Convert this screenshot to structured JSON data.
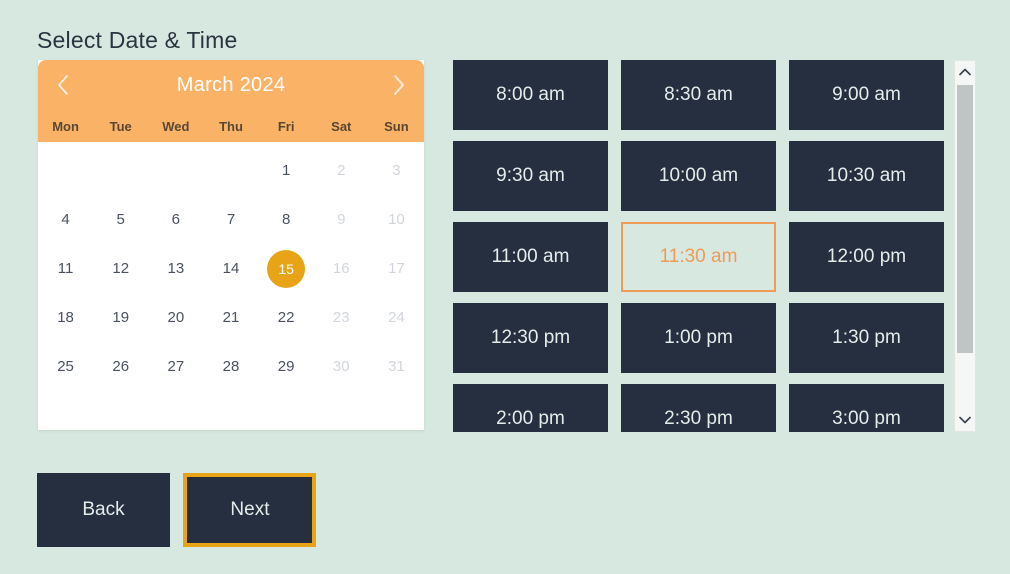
{
  "page": {
    "title": "Select Date & Time",
    "background_color": "#d6e8df",
    "accent_color": "#f9b266",
    "selected_color": "#e8a317",
    "slot_color": "#252f40"
  },
  "calendar": {
    "month_label": "March 2024",
    "prev_icon": "chevron-left-icon",
    "next_icon": "chevron-right-icon",
    "weekdays": [
      "Mon",
      "Tue",
      "Wed",
      "Thu",
      "Fri",
      "Sat",
      "Sun"
    ],
    "leading_blanks": 4,
    "selected_day": 15,
    "days": [
      {
        "n": "1",
        "state": "enabled"
      },
      {
        "n": "2",
        "state": "disabled"
      },
      {
        "n": "3",
        "state": "disabled"
      },
      {
        "n": "4",
        "state": "enabled"
      },
      {
        "n": "5",
        "state": "enabled"
      },
      {
        "n": "6",
        "state": "enabled"
      },
      {
        "n": "7",
        "state": "enabled"
      },
      {
        "n": "8",
        "state": "enabled"
      },
      {
        "n": "9",
        "state": "disabled"
      },
      {
        "n": "10",
        "state": "disabled"
      },
      {
        "n": "11",
        "state": "enabled"
      },
      {
        "n": "12",
        "state": "enabled"
      },
      {
        "n": "13",
        "state": "enabled"
      },
      {
        "n": "14",
        "state": "enabled"
      },
      {
        "n": "15",
        "state": "selected"
      },
      {
        "n": "16",
        "state": "disabled"
      },
      {
        "n": "17",
        "state": "disabled"
      },
      {
        "n": "18",
        "state": "enabled"
      },
      {
        "n": "19",
        "state": "enabled"
      },
      {
        "n": "20",
        "state": "enabled"
      },
      {
        "n": "21",
        "state": "enabled"
      },
      {
        "n": "22",
        "state": "enabled"
      },
      {
        "n": "23",
        "state": "disabled"
      },
      {
        "n": "24",
        "state": "disabled"
      },
      {
        "n": "25",
        "state": "enabled"
      },
      {
        "n": "26",
        "state": "enabled"
      },
      {
        "n": "27",
        "state": "enabled"
      },
      {
        "n": "28",
        "state": "enabled"
      },
      {
        "n": "29",
        "state": "enabled"
      },
      {
        "n": "30",
        "state": "disabled"
      },
      {
        "n": "31",
        "state": "disabled"
      }
    ]
  },
  "time_slots": {
    "selected": "11:30 am",
    "items": [
      {
        "label": "8:00 am",
        "state": "enabled"
      },
      {
        "label": "8:30 am",
        "state": "enabled"
      },
      {
        "label": "9:00 am",
        "state": "enabled"
      },
      {
        "label": "9:30 am",
        "state": "enabled"
      },
      {
        "label": "10:00 am",
        "state": "enabled"
      },
      {
        "label": "10:30 am",
        "state": "enabled"
      },
      {
        "label": "11:00 am",
        "state": "enabled"
      },
      {
        "label": "11:30 am",
        "state": "selected"
      },
      {
        "label": "12:00 pm",
        "state": "enabled"
      },
      {
        "label": "12:30 pm",
        "state": "enabled"
      },
      {
        "label": "1:00 pm",
        "state": "enabled"
      },
      {
        "label": "1:30 pm",
        "state": "enabled"
      },
      {
        "label": "2:00 pm",
        "state": "enabled"
      },
      {
        "label": "2:30 pm",
        "state": "enabled"
      },
      {
        "label": "3:00 pm",
        "state": "enabled"
      }
    ]
  },
  "scrollbar": {
    "up_icon": "chevron-up-icon",
    "down_icon": "chevron-down-icon"
  },
  "footer": {
    "back_label": "Back",
    "next_label": "Next"
  }
}
